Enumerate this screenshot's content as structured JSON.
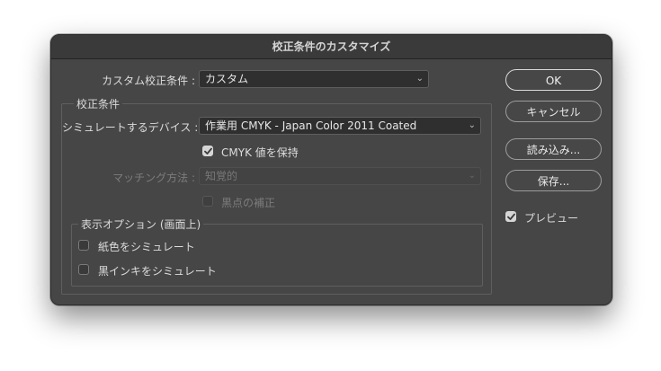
{
  "dialog": {
    "title": "校正条件のカスタマイズ"
  },
  "preset": {
    "label": "カスタム校正条件 :",
    "value": "カスタム"
  },
  "proof_group": {
    "title": "校正条件",
    "device_label": "シミュレートするデバイス :",
    "device_value": "作業用 CMYK - Japan Color 2011 Coated",
    "preserve_label": "CMYK 値を保持",
    "preserve_checked": true,
    "intent_label": "マッチング方法 :",
    "intent_value": "知覚的",
    "bpc_label": "黒点の補正",
    "bpc_checked": false
  },
  "display_group": {
    "title": "表示オプション (画面上)",
    "paper_label": "紙色をシミュレート",
    "paper_checked": false,
    "ink_label": "黒インキをシミュレート",
    "ink_checked": false
  },
  "buttons": {
    "ok": "OK",
    "cancel": "キャンセル",
    "load": "読み込み...",
    "save": "保存..."
  },
  "preview": {
    "label": "プレビュー",
    "checked": true
  },
  "icons": {
    "chevron": "chevron-down-icon",
    "check": "checkmark-icon"
  }
}
